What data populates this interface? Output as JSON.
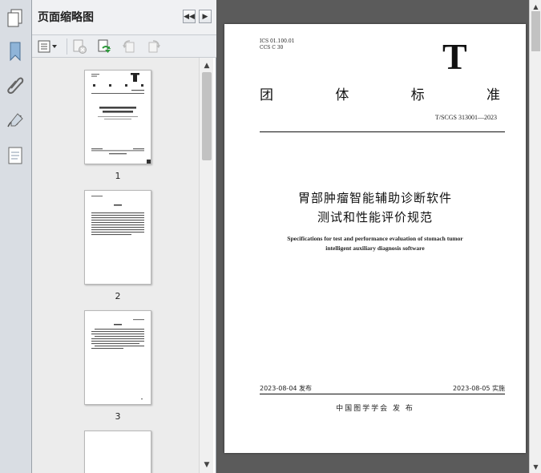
{
  "panel": {
    "title": "页面缩略图"
  },
  "thumbnails": [
    {
      "page": "1"
    },
    {
      "page": "2"
    },
    {
      "page": "3"
    }
  ],
  "document": {
    "ics": "ICS 01.100.01",
    "ccs": "CCS C 30",
    "letter": "T",
    "heading_chars": [
      "团",
      "体",
      "标",
      "准"
    ],
    "standard_no": "T/SCGS 313001—2023",
    "title_line1": "胃部肿瘤智能辅助诊断软件",
    "title_line2": "测试和性能评价规范",
    "english_line1": "Specifications for test and performance evaluation of stomach tumor",
    "english_line2": "intelligent auxiliary diagnosis software",
    "published": "2023-08-04 发布",
    "implemented": "2023-08-05 实施",
    "organization": "中国图学学会   发 布"
  },
  "icons": {
    "rail": [
      "pages-icon",
      "bookmark-icon",
      "attachment-icon",
      "signature-icon",
      "layers-icon"
    ],
    "toolbar": [
      "thumbnail-options-icon",
      "delete-page-icon",
      "insert-page-icon",
      "rotate-ccw-icon",
      "rotate-cw-icon"
    ]
  }
}
